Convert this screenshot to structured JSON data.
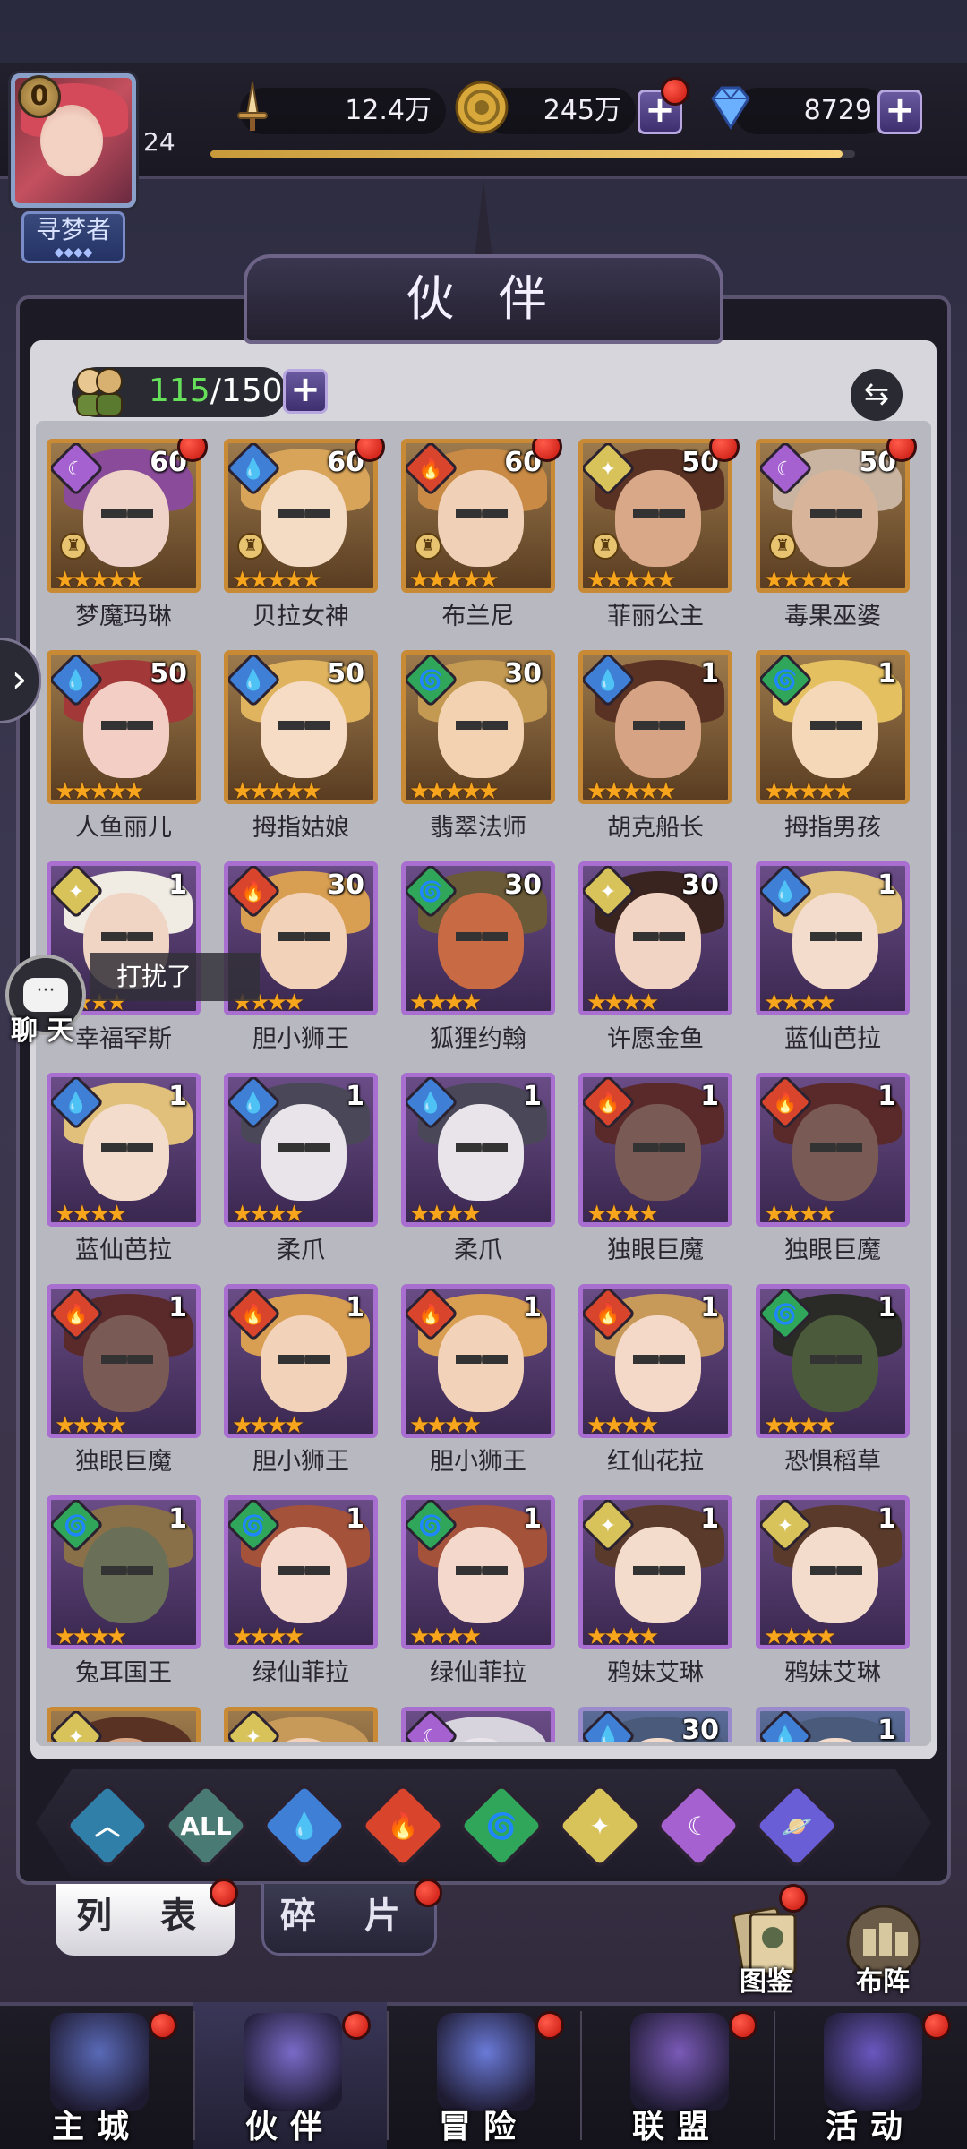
{
  "player": {
    "vip": "0",
    "level": "24",
    "title": "寻梦者",
    "title_dots": "◆◆◆◆"
  },
  "resources": {
    "power": "12.4万",
    "gold": "245万",
    "diamonds": "8729",
    "xp_fraction": 0.98
  },
  "page": {
    "title": "伙 伴"
  },
  "roster": {
    "count_current": "115",
    "count_max": "/150",
    "sort_icon": "⇆"
  },
  "heroes": [
    {
      "name": "梦魔玛琳",
      "level": "60",
      "element": "moon",
      "stars": "★★★★★",
      "frame": "gold",
      "skin": "#efd3c8",
      "hair": "#8a4c9a",
      "awaken": true,
      "dot": true
    },
    {
      "name": "贝拉女神",
      "level": "60",
      "element": "water",
      "stars": "★★★★★",
      "frame": "gold",
      "skin": "#f4dcc4",
      "hair": "#d8a45a",
      "awaken": true,
      "dot": true
    },
    {
      "name": "布兰尼",
      "level": "60",
      "element": "fire",
      "stars": "★★★★★",
      "frame": "gold",
      "skin": "#f0d0b6",
      "hair": "#c88a44",
      "awaken": true,
      "dot": true
    },
    {
      "name": "菲丽公主",
      "level": "50",
      "element": "light",
      "stars": "★★★★★",
      "frame": "gold",
      "skin": "#d9a888",
      "hair": "#5a3224",
      "awaken": true,
      "dot": true
    },
    {
      "name": "毒果巫婆",
      "level": "50",
      "element": "moon",
      "stars": "★★★★★",
      "frame": "gold",
      "skin": "#d8b59a",
      "hair": "#c8b4a0",
      "awaken": true,
      "dot": true
    },
    {
      "name": "人鱼丽儿",
      "level": "50",
      "element": "water",
      "stars": "★★★★★",
      "frame": "gold",
      "skin": "#f2cec4",
      "hair": "#a23838",
      "awaken": false,
      "dot": false
    },
    {
      "name": "拇指姑娘",
      "level": "50",
      "element": "water",
      "stars": "★★★★★",
      "frame": "gold",
      "skin": "#f6dcc4",
      "hair": "#e0b45e",
      "awaken": false,
      "dot": false
    },
    {
      "name": "翡翠法师",
      "level": "30",
      "element": "wind",
      "stars": "★★★★★",
      "frame": "gold",
      "skin": "#f2d2b0",
      "hair": "#c49a52",
      "awaken": false,
      "dot": false
    },
    {
      "name": "胡克船长",
      "level": "1",
      "element": "water",
      "stars": "★★★★★",
      "frame": "gold",
      "skin": "#d6a484",
      "hair": "#5a3224",
      "awaken": false,
      "dot": false
    },
    {
      "name": "拇指男孩",
      "level": "1",
      "element": "wind",
      "stars": "★★★★★",
      "frame": "gold",
      "skin": "#f4d8b8",
      "hair": "#e4c060",
      "awaken": false,
      "dot": false
    },
    {
      "name": "幸福罕斯",
      "level": "1",
      "element": "light",
      "stars": "★★★★",
      "frame": "purple",
      "skin": "#f0d4c4",
      "hair": "#f0ece4",
      "awaken": false,
      "dot": false
    },
    {
      "name": "胆小狮王",
      "level": "30",
      "element": "fire",
      "stars": "★★★★",
      "frame": "purple",
      "skin": "#f2d2b8",
      "hair": "#d89e52",
      "awaken": false,
      "dot": false
    },
    {
      "name": "狐狸约翰",
      "level": "30",
      "element": "wind",
      "stars": "★★★★",
      "frame": "purple",
      "skin": "#c86a44",
      "hair": "#6a5a38",
      "awaken": false,
      "dot": false
    },
    {
      "name": "许愿金鱼",
      "level": "30",
      "element": "light",
      "stars": "★★★★",
      "frame": "purple",
      "skin": "#f2d4c4",
      "hair": "#3a2420",
      "awaken": false,
      "dot": false
    },
    {
      "name": "蓝仙芭拉",
      "level": "1",
      "element": "water",
      "stars": "★★★★",
      "frame": "purple",
      "skin": "#f4dccc",
      "hair": "#e0c07a",
      "awaken": false,
      "dot": false
    },
    {
      "name": "蓝仙芭拉",
      "level": "1",
      "element": "water",
      "stars": "★★★★",
      "frame": "purple",
      "skin": "#f4dccc",
      "hair": "#e0c07a",
      "awaken": false,
      "dot": false
    },
    {
      "name": "柔爪",
      "level": "1",
      "element": "water",
      "stars": "★★★★",
      "frame": "purple",
      "skin": "#e8e4ea",
      "hair": "#4a4858",
      "awaken": false,
      "dot": false
    },
    {
      "name": "柔爪",
      "level": "1",
      "element": "water",
      "stars": "★★★★",
      "frame": "purple",
      "skin": "#e8e4ea",
      "hair": "#4a4858",
      "awaken": false,
      "dot": false
    },
    {
      "name": "独眼巨魔",
      "level": "1",
      "element": "fire",
      "stars": "★★★★",
      "frame": "purple",
      "skin": "#7a5a54",
      "hair": "#5a2a2a",
      "awaken": false,
      "dot": false
    },
    {
      "name": "独眼巨魔",
      "level": "1",
      "element": "fire",
      "stars": "★★★★",
      "frame": "purple",
      "skin": "#7a5a54",
      "hair": "#5a2a2a",
      "awaken": false,
      "dot": false
    },
    {
      "name": "独眼巨魔",
      "level": "1",
      "element": "fire",
      "stars": "★★★★",
      "frame": "purple",
      "skin": "#7a5a54",
      "hair": "#5a2a2a",
      "awaken": false,
      "dot": false
    },
    {
      "name": "胆小狮王",
      "level": "1",
      "element": "fire",
      "stars": "★★★★",
      "frame": "purple",
      "skin": "#f2d2b8",
      "hair": "#d89e52",
      "awaken": false,
      "dot": false
    },
    {
      "name": "胆小狮王",
      "level": "1",
      "element": "fire",
      "stars": "★★★★",
      "frame": "purple",
      "skin": "#f2d2b8",
      "hair": "#d89e52",
      "awaken": false,
      "dot": false
    },
    {
      "name": "红仙花拉",
      "level": "1",
      "element": "fire",
      "stars": "★★★★",
      "frame": "purple",
      "skin": "#f4d8c8",
      "hair": "#c89a5a",
      "awaken": false,
      "dot": false
    },
    {
      "name": "恐惧稻草",
      "level": "1",
      "element": "wind",
      "stars": "★★★★",
      "frame": "purple",
      "skin": "#4a5a3a",
      "hair": "#2a2a26",
      "awaken": false,
      "dot": false
    },
    {
      "name": "兔耳国王",
      "level": "1",
      "element": "wind",
      "stars": "★★★★",
      "frame": "purple",
      "skin": "#6a7058",
      "hair": "#8a7048",
      "awaken": false,
      "dot": false
    },
    {
      "name": "绿仙菲拉",
      "level": "1",
      "element": "wind",
      "stars": "★★★★",
      "frame": "purple",
      "skin": "#f4d8cc",
      "hair": "#a4523a",
      "awaken": false,
      "dot": false
    },
    {
      "name": "绿仙菲拉",
      "level": "1",
      "element": "wind",
      "stars": "★★★★",
      "frame": "purple",
      "skin": "#f4d8cc",
      "hair": "#a4523a",
      "awaken": false,
      "dot": false
    },
    {
      "name": "鸦妹艾琳",
      "level": "1",
      "element": "light",
      "stars": "★★★★",
      "frame": "purple",
      "skin": "#f4dccc",
      "hair": "#5a3a2a",
      "awaken": false,
      "dot": false
    },
    {
      "name": "鸦妹艾琳",
      "level": "1",
      "element": "light",
      "stars": "★★★★",
      "frame": "purple",
      "skin": "#f4dccc",
      "hair": "#5a3a2a",
      "awaken": false,
      "dot": false
    },
    {
      "name": "",
      "level": "",
      "element": "light",
      "stars": "",
      "frame": "gold",
      "skin": "#d9a888",
      "hair": "#5a3224",
      "awaken": false,
      "dot": false
    },
    {
      "name": "",
      "level": "",
      "element": "light",
      "stars": "",
      "frame": "gold",
      "skin": "#f2d2b8",
      "hair": "#c89a5a",
      "awaken": false,
      "dot": false
    },
    {
      "name": "",
      "level": "",
      "element": "moon",
      "stars": "",
      "frame": "purple",
      "skin": "#e8e4ea",
      "hair": "#d8d4de",
      "awaken": false,
      "dot": false
    },
    {
      "name": "",
      "level": "30",
      "element": "water",
      "stars": "",
      "frame": "blue",
      "skin": "#f4dccc",
      "hair": "#4a5a7a",
      "awaken": false,
      "dot": false
    },
    {
      "name": "",
      "level": "1",
      "element": "water",
      "stars": "",
      "frame": "blue",
      "skin": "#f4dccc",
      "hair": "#4a5a7a",
      "awaken": false,
      "dot": false
    }
  ],
  "element_colors": {
    "water": "#3f7fd6",
    "fire": "#d8452c",
    "wind": "#2fa65a",
    "light": "#d8c25a",
    "moon": "#a561d0",
    "cosmos": "#6a5ed6",
    "all": "#4a7a74"
  },
  "element_glyphs": {
    "water": "💧",
    "fire": "🔥",
    "wind": "🌀",
    "light": "✦",
    "moon": "☾",
    "cosmos": "🪐",
    "all": "ALL"
  },
  "filters": [
    {
      "key": "all",
      "label": "ALL"
    },
    {
      "key": "water",
      "label": "💧"
    },
    {
      "key": "fire",
      "label": "🔥"
    },
    {
      "key": "wind",
      "label": "🌀"
    },
    {
      "key": "light",
      "label": "✦"
    },
    {
      "key": "moon",
      "label": "☾"
    },
    {
      "key": "cosmos",
      "label": "🪐"
    }
  ],
  "chat": {
    "label": "聊 天",
    "toast": "打扰了",
    "bubble": "···"
  },
  "side_arrow": "›",
  "sub_tabs": {
    "list": "列 表",
    "fragments": "碎 片"
  },
  "side_buttons": {
    "codex": "图鉴",
    "formation": "布阵"
  },
  "nav": [
    {
      "label": "主城",
      "icon": "castle-icon",
      "color": "#5a6ab8"
    },
    {
      "label": "伙伴",
      "icon": "wizard-hat-icon",
      "color": "#7a6ac8"
    },
    {
      "label": "冒险",
      "icon": "compass-icon",
      "color": "#6a7ad8"
    },
    {
      "label": "联盟",
      "icon": "shield-icon",
      "color": "#7a5ab8"
    },
    {
      "label": "活动",
      "icon": "cards-icon",
      "color": "#6a58c0"
    }
  ]
}
